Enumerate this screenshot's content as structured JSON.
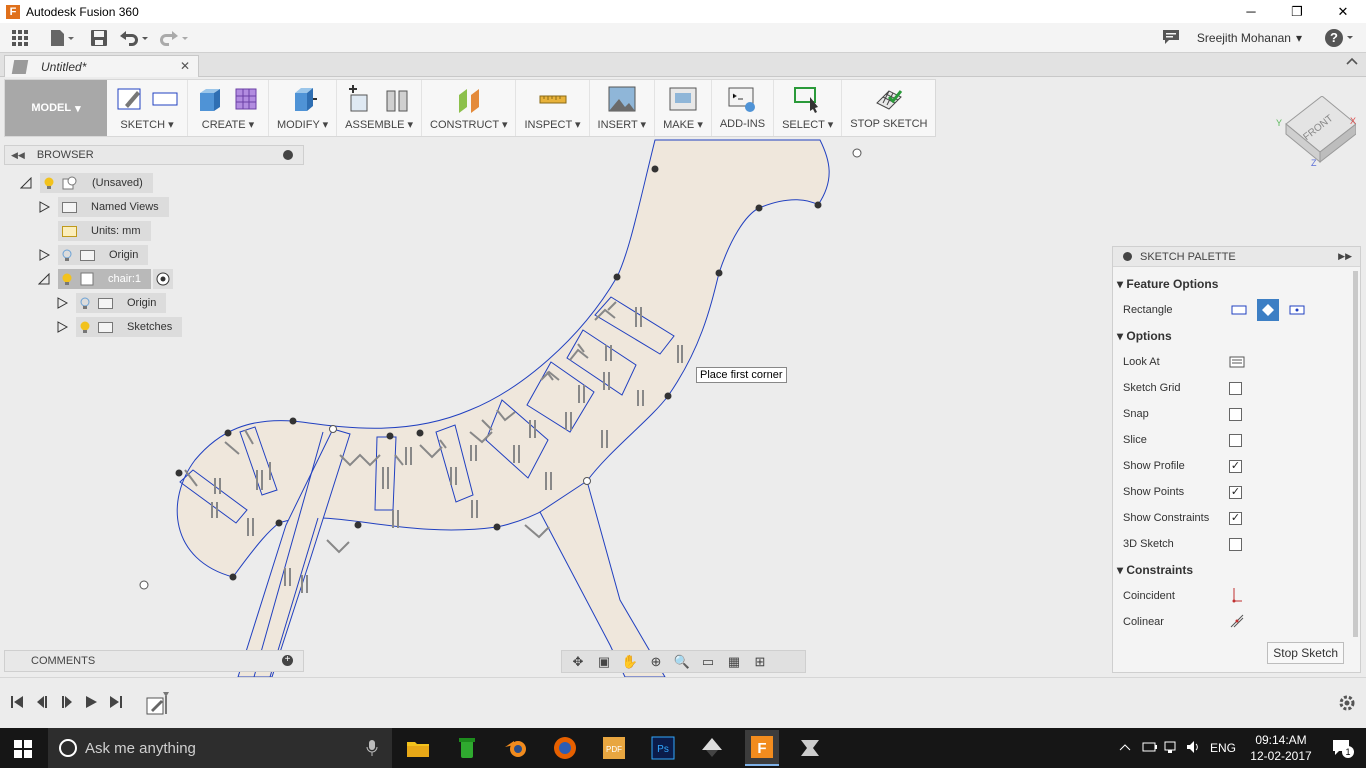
{
  "window": {
    "title": "Autodesk Fusion 360",
    "app_icon_letter": "F",
    "minimize": "─",
    "maximize": "❐",
    "close": "✕"
  },
  "quick_access": {
    "user_name": "Sreejith Mohanan",
    "user_caret": "▾",
    "help_caret": "▾"
  },
  "document_tab": {
    "label": "Untitled*",
    "close": "✕"
  },
  "toolbar": {
    "mode": "MODEL",
    "groups": [
      {
        "label": "SKETCH"
      },
      {
        "label": "CREATE"
      },
      {
        "label": "MODIFY"
      },
      {
        "label": "ASSEMBLE"
      },
      {
        "label": "CONSTRUCT"
      },
      {
        "label": "INSPECT"
      },
      {
        "label": "INSERT"
      },
      {
        "label": "MAKE"
      },
      {
        "label": "ADD-INS"
      },
      {
        "label": "SELECT"
      },
      {
        "label": "STOP SKETCH"
      }
    ]
  },
  "browser": {
    "title": "BROWSER",
    "items": [
      {
        "label": "(Unsaved)"
      },
      {
        "label": "Named Views"
      },
      {
        "label": "Units: mm"
      },
      {
        "label": "Origin"
      },
      {
        "label": "chair:1"
      },
      {
        "label": "Origin"
      },
      {
        "label": "Sketches"
      }
    ]
  },
  "comments": {
    "title": "COMMENTS"
  },
  "tooltip": "Place first corner",
  "viewcube": {
    "face": "FRONT",
    "axis_x": "X",
    "axis_y": "Y",
    "axis_z": "Z"
  },
  "sketch_palette": {
    "title": "SKETCH PALETTE",
    "sections": {
      "feature_options": "Feature Options",
      "options": "Options",
      "constraints": "Constraints"
    },
    "rectangle_label": "Rectangle",
    "options": [
      {
        "label": "Look At"
      },
      {
        "label": "Sketch Grid",
        "checked": false
      },
      {
        "label": "Snap",
        "checked": false
      },
      {
        "label": "Slice",
        "checked": false
      },
      {
        "label": "Show Profile",
        "checked": true
      },
      {
        "label": "Show Points",
        "checked": true
      },
      {
        "label": "Show Constraints",
        "checked": true
      },
      {
        "label": "3D Sketch",
        "checked": false
      }
    ],
    "constraints": [
      {
        "label": "Coincident"
      },
      {
        "label": "Colinear"
      }
    ],
    "stop_button": "Stop Sketch"
  },
  "taskbar": {
    "search_placeholder": "Ask me anything",
    "language": "ENG",
    "time": "09:14:AM",
    "date": "12-02-2017",
    "notification_count": "1"
  },
  "colors": {
    "profile_fill": "#efe7dc",
    "sketch_line": "#1f3fbf",
    "mode_bg": "#a8a8a8",
    "taskbar": "#161616"
  }
}
